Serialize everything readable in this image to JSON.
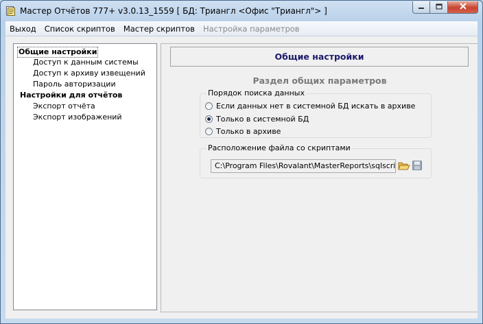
{
  "window": {
    "title": "Мастер Отчётов 777+ v3.0.13_1559 [ БД: Триангл <Офис \"Триангл\"> ]",
    "app_icon": "report-app-icon",
    "buttons": {
      "minimize_icon": "minimize-icon",
      "maximize_icon": "maximize-icon",
      "close_icon": "close-icon"
    }
  },
  "menu": {
    "items": [
      {
        "label": "Выход",
        "enabled": true
      },
      {
        "label": "Список скриптов",
        "enabled": true
      },
      {
        "label": "Мастер скриптов",
        "enabled": true
      },
      {
        "label": "Настройка параметров",
        "enabled": false
      }
    ]
  },
  "tree": {
    "items": [
      {
        "label": "Общие настройки",
        "level": 0,
        "bold": true,
        "selected": true
      },
      {
        "label": "Доступ к данным системы",
        "level": 1,
        "bold": false,
        "selected": false
      },
      {
        "label": "Доступ к архиву извещений",
        "level": 1,
        "bold": false,
        "selected": false
      },
      {
        "label": "Пароль авторизации",
        "level": 1,
        "bold": false,
        "selected": false
      },
      {
        "label": "Настройки для отчётов",
        "level": 0,
        "bold": true,
        "selected": false
      },
      {
        "label": "Экспорт отчёта",
        "level": 1,
        "bold": false,
        "selected": false
      },
      {
        "label": "Экспорт изображений",
        "level": 1,
        "bold": false,
        "selected": false
      }
    ]
  },
  "panel": {
    "header": "Общие настройки",
    "subtitle": "Раздел общих параметров",
    "search_group": {
      "legend": "Порядок поиска данных",
      "options": [
        {
          "label": "Если данных нет в системной БД искать в архиве",
          "checked": false
        },
        {
          "label": "Только в системной БД",
          "checked": true
        },
        {
          "label": "Только в архиве",
          "checked": false
        }
      ]
    },
    "file_group": {
      "legend": "Расположение файла со скриптами",
      "path": "C:\\Program Files\\Rovalant\\MasterReports\\sqlscript.xml",
      "browse_icon": "folder-open-icon",
      "save_icon": "save-disk-icon"
    }
  },
  "colors": {
    "header_text": "#1a1a6a",
    "subtitle_text": "#7a7a7a",
    "close_button": "#c7432f"
  }
}
